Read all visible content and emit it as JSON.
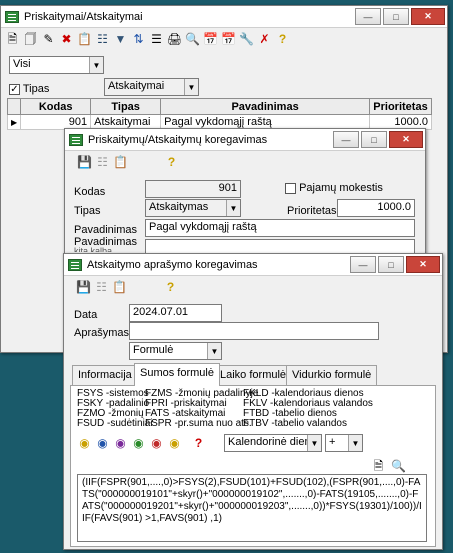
{
  "main": {
    "title": "Priskaitymai/Atskaitymai",
    "filter_value": "Visi",
    "tipas_label": "Tipas",
    "tipas_checked": true,
    "tipas_value": "Atskaitymai",
    "columns": [
      "Kodas",
      "Tipas",
      "Pavadinimas",
      "Prioritetas"
    ],
    "row": {
      "kodas": "901",
      "tipas": "Atskaitymai",
      "pavadinimas": "Pagal vykdomąjį raštą",
      "prioritetas": "1000.0"
    }
  },
  "edit": {
    "title": "Priskaitymų/Atskaitymų koregavimas",
    "kodas_label": "Kodas",
    "kodas_value": "901",
    "pajamu_label": "Pajamų mokestis",
    "tipas_label": "Tipas",
    "tipas_value": "Atskaitymas",
    "prioritetas_label": "Prioritetas",
    "prioritetas_value": "1000.0",
    "pavadinimas_label": "Pavadinimas",
    "pavadinimas_value": "Pagal vykdomąjį raštą",
    "pavadinimas2_label": "Pavadinimas",
    "pavadinimas2_sub": "kita kalba"
  },
  "desc": {
    "title": "Atskaitymo aprašymo koregavimas",
    "data_label": "Data",
    "data_value": "2024.07.01",
    "aprasymas_label": "Aprašymas",
    "aprasymas_value": "",
    "type_value": "Formulė",
    "tabs": [
      "Informacija",
      "Sumos formulė",
      "Laiko formulė",
      "Vidurkio formulė"
    ],
    "active_tab": 1,
    "functions": [
      [
        "FSYS -sistemos",
        "FZMS -žmonių padalinyje",
        "FKLD -kalendoriaus dienos"
      ],
      [
        "FSKY -padalinio",
        "FPRI -priskaitymai",
        "FKLV -kalendoriaus valandos"
      ],
      [
        "FZMO -žmonių",
        "FATS -atskaitymai",
        "FTBD -tabelio dienos"
      ],
      [
        "FSUD -sudėtiniai",
        "FSPR -pr.suma nuo ats.",
        "FTBV -tabelio valandos"
      ]
    ],
    "calendar_value": "Kalendorinė dieno",
    "operator_value": "+",
    "formula": "(IIF(FSPR(901,....,0)>FSYS(2),FSUD(101)+FSUD(102),(FSPR(901,....,0)-FATS(\"000000019101\"+skyr()+\"000000019102\",.......,0)-FATS(19105,.......,0)-FATS(\"000000019201\"+skyr()+\"000000019203\",.......,0))*FSYS(19301)/100))/IIF(FAVS(901) >1,FAVS(901) ,1)"
  }
}
